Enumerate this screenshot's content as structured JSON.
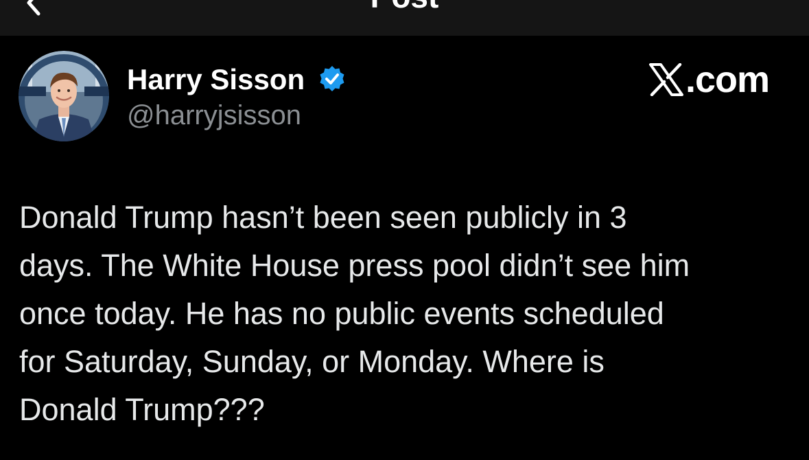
{
  "header": {
    "title": "Post",
    "back_icon": "back-arrow-icon"
  },
  "author": {
    "display_name": "Harry Sisson",
    "handle": "@harryjsisson",
    "verified_icon": "verified-badge-icon",
    "verified_color": "#1d9bf0",
    "avatar_icon": "avatar-photo"
  },
  "brand": {
    "text": ".com",
    "logo_icon": "x-logo-icon"
  },
  "tweet": {
    "lines": [
      "Donald Trump hasn’t been seen publicly in 3",
      "days. The White House press pool didn’t see him",
      "once today. He has no public events scheduled",
      "for Saturday, Sunday, or Monday. Where is",
      "Donald Trump???"
    ]
  },
  "colors": {
    "background": "#000000",
    "header_background": "#151515",
    "primary_text": "#e7e9ea",
    "secondary_text": "#8b8f93"
  }
}
